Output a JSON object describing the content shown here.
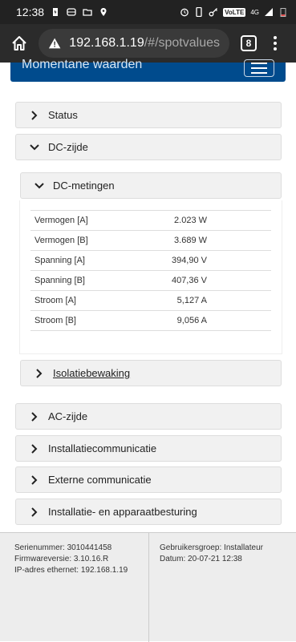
{
  "status_bar": {
    "time": "12:38",
    "left_icons": [
      "charging-icon",
      "transit-icon",
      "folder-icon",
      "location-icon"
    ],
    "right_icons": [
      "alarm-icon",
      "phone-icon",
      "key-icon",
      "volte-badge",
      "signal-icon",
      "battery-icon"
    ],
    "volte_label": "VoLTE",
    "network_label": "4G"
  },
  "browser": {
    "url_host": "192.168.1.19",
    "url_path": "/#/spotvalues",
    "tab_count": "8"
  },
  "navbar": {
    "title": "Momentane waarden"
  },
  "panels": {
    "status": "Status",
    "dc_side": "DC-zijde",
    "dc_measurements": "DC-metingen",
    "insulation": "Isolatiebewaking",
    "ac_side": "AC-zijde",
    "installation_comm": "Installatiecommunicatie",
    "external_comm": "Externe communicatie",
    "installation_control": "Installatie- en apparaatbesturing"
  },
  "measurements": [
    {
      "label": "Vermogen [A]",
      "value": "2.023 W"
    },
    {
      "label": "Vermogen [B]",
      "value": "3.689 W"
    },
    {
      "label": "Spanning [A]",
      "value": "394,90 V"
    },
    {
      "label": "Spanning [B]",
      "value": "407,36 V"
    },
    {
      "label": "Stroom [A]",
      "value": "5,127 A"
    },
    {
      "label": "Stroom [B]",
      "value": "9,056 A"
    }
  ],
  "footer": {
    "serial": "Serienummer: 3010441458",
    "firmware": "Firmwareversie: 3.10.16.R",
    "ip": "IP-adres ethernet: 192.168.1.19",
    "user_group": "Gebruikersgroep: Installateur",
    "date": "Datum: 20-07-21 12:38"
  },
  "colors": {
    "navbar": "#004b8d",
    "panel_bg": "#f1f1f1",
    "status_bar": "#222222",
    "browser_bar": "#2b2b2b"
  }
}
